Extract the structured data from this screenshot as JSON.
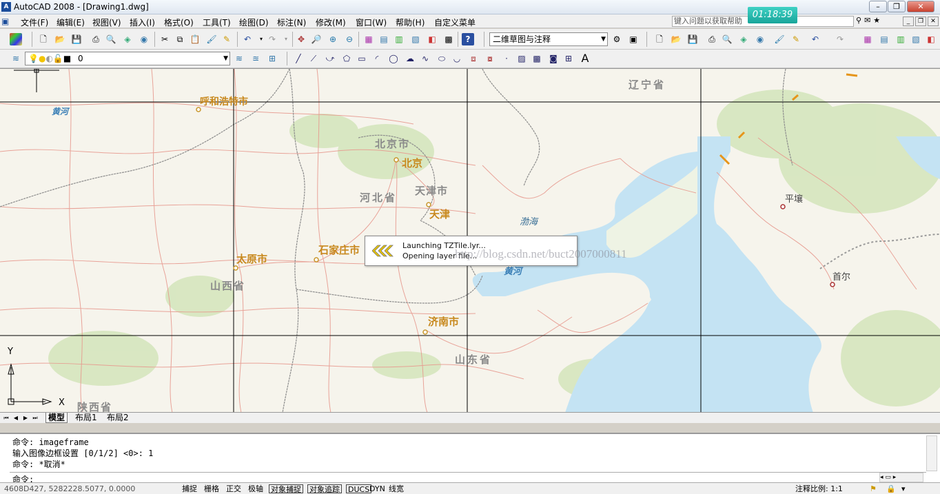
{
  "window": {
    "title": "AutoCAD 2008 - [Drawing1.dwg]",
    "clock": "01:18:39"
  },
  "menu": [
    "文件(F)",
    "编辑(E)",
    "视图(V)",
    "插入(I)",
    "格式(O)",
    "工具(T)",
    "绘图(D)",
    "标注(N)",
    "修改(M)",
    "窗口(W)",
    "帮助(H)",
    "自定义菜单"
  ],
  "help": {
    "placeholder": "键入问题以获取帮助"
  },
  "toolbar": {
    "workspace": "二维草图与注释",
    "layer": "0",
    "text_tool": "A"
  },
  "map": {
    "labels": {
      "huhehaote": "呼和浩特市",
      "huanghe1": "黄河",
      "beijing_city": "北京市",
      "beijing": "北京",
      "tianjin_city": "天津市",
      "tianjin": "天津",
      "hebei": "河北省",
      "bohai": "渤海",
      "shijiazhuang": "石家庄市",
      "taiyuan": "太原市",
      "shanxi": "山西省",
      "huanghe2": "黄河",
      "jinan": "济南市",
      "shandong": "山东省",
      "shaanxi": "陕西省",
      "liaoning": "辽宁省",
      "pyongyang": "平壤",
      "seoul": "首尔"
    },
    "ucs": {
      "y": "Y",
      "x": "X"
    }
  },
  "dialog": {
    "line1": "Launching TZTile.lyr...",
    "line2": "Opening layer file..."
  },
  "watermark": "http://blog.csdn.net/buct2007000811",
  "tabs": [
    "模型",
    "布局1",
    "布局2"
  ],
  "command": {
    "lines": [
      "命令: imageframe",
      "输入图像边框设置 [0/1/2] <0>:  1",
      "命令: *取消*"
    ],
    "prompt": "命令:"
  },
  "status": {
    "coords": "4608D427, 5282228.5077, 0.0000",
    "toggles": [
      "捕捉",
      "栅格",
      "正交",
      "极轴",
      "对象捕捉",
      "对象追踪",
      "DUCS",
      "DYN",
      "线宽"
    ],
    "scale": "注释比例: 1:1"
  }
}
